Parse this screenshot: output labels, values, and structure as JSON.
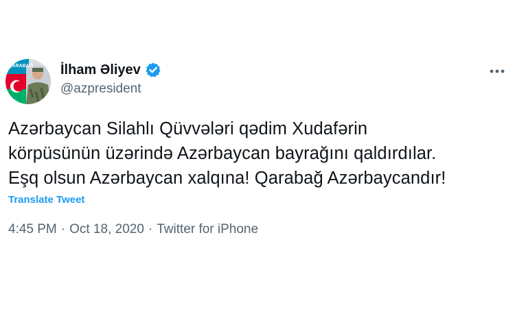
{
  "author": {
    "display_name": "İlham Əliyev",
    "handle": "@azpresident",
    "verified_icon": "verified-badge-icon",
    "avatar_text": "QARABAĞ"
  },
  "menu_icon": "more-horizontal-icon",
  "tweet": {
    "lines": [
      "Azərbaycan Silahlı Qüvvələri qədim Xudafərin",
      "körpüsünün üzərində Azərbaycan bayrağını qaldırdılar.",
      "Eşq olsun Azərbaycan xalqına! Qarabağ Azərbaycandır!"
    ],
    "translate_label": "Translate Tweet",
    "time": "4:45 PM",
    "date": "Oct 18, 2020",
    "separator": "·",
    "source": "Twitter for iPhone"
  },
  "colors": {
    "text": "#0f1419",
    "secondary": "#536471",
    "accent": "#1d9bf0",
    "background": "#ffffff"
  }
}
